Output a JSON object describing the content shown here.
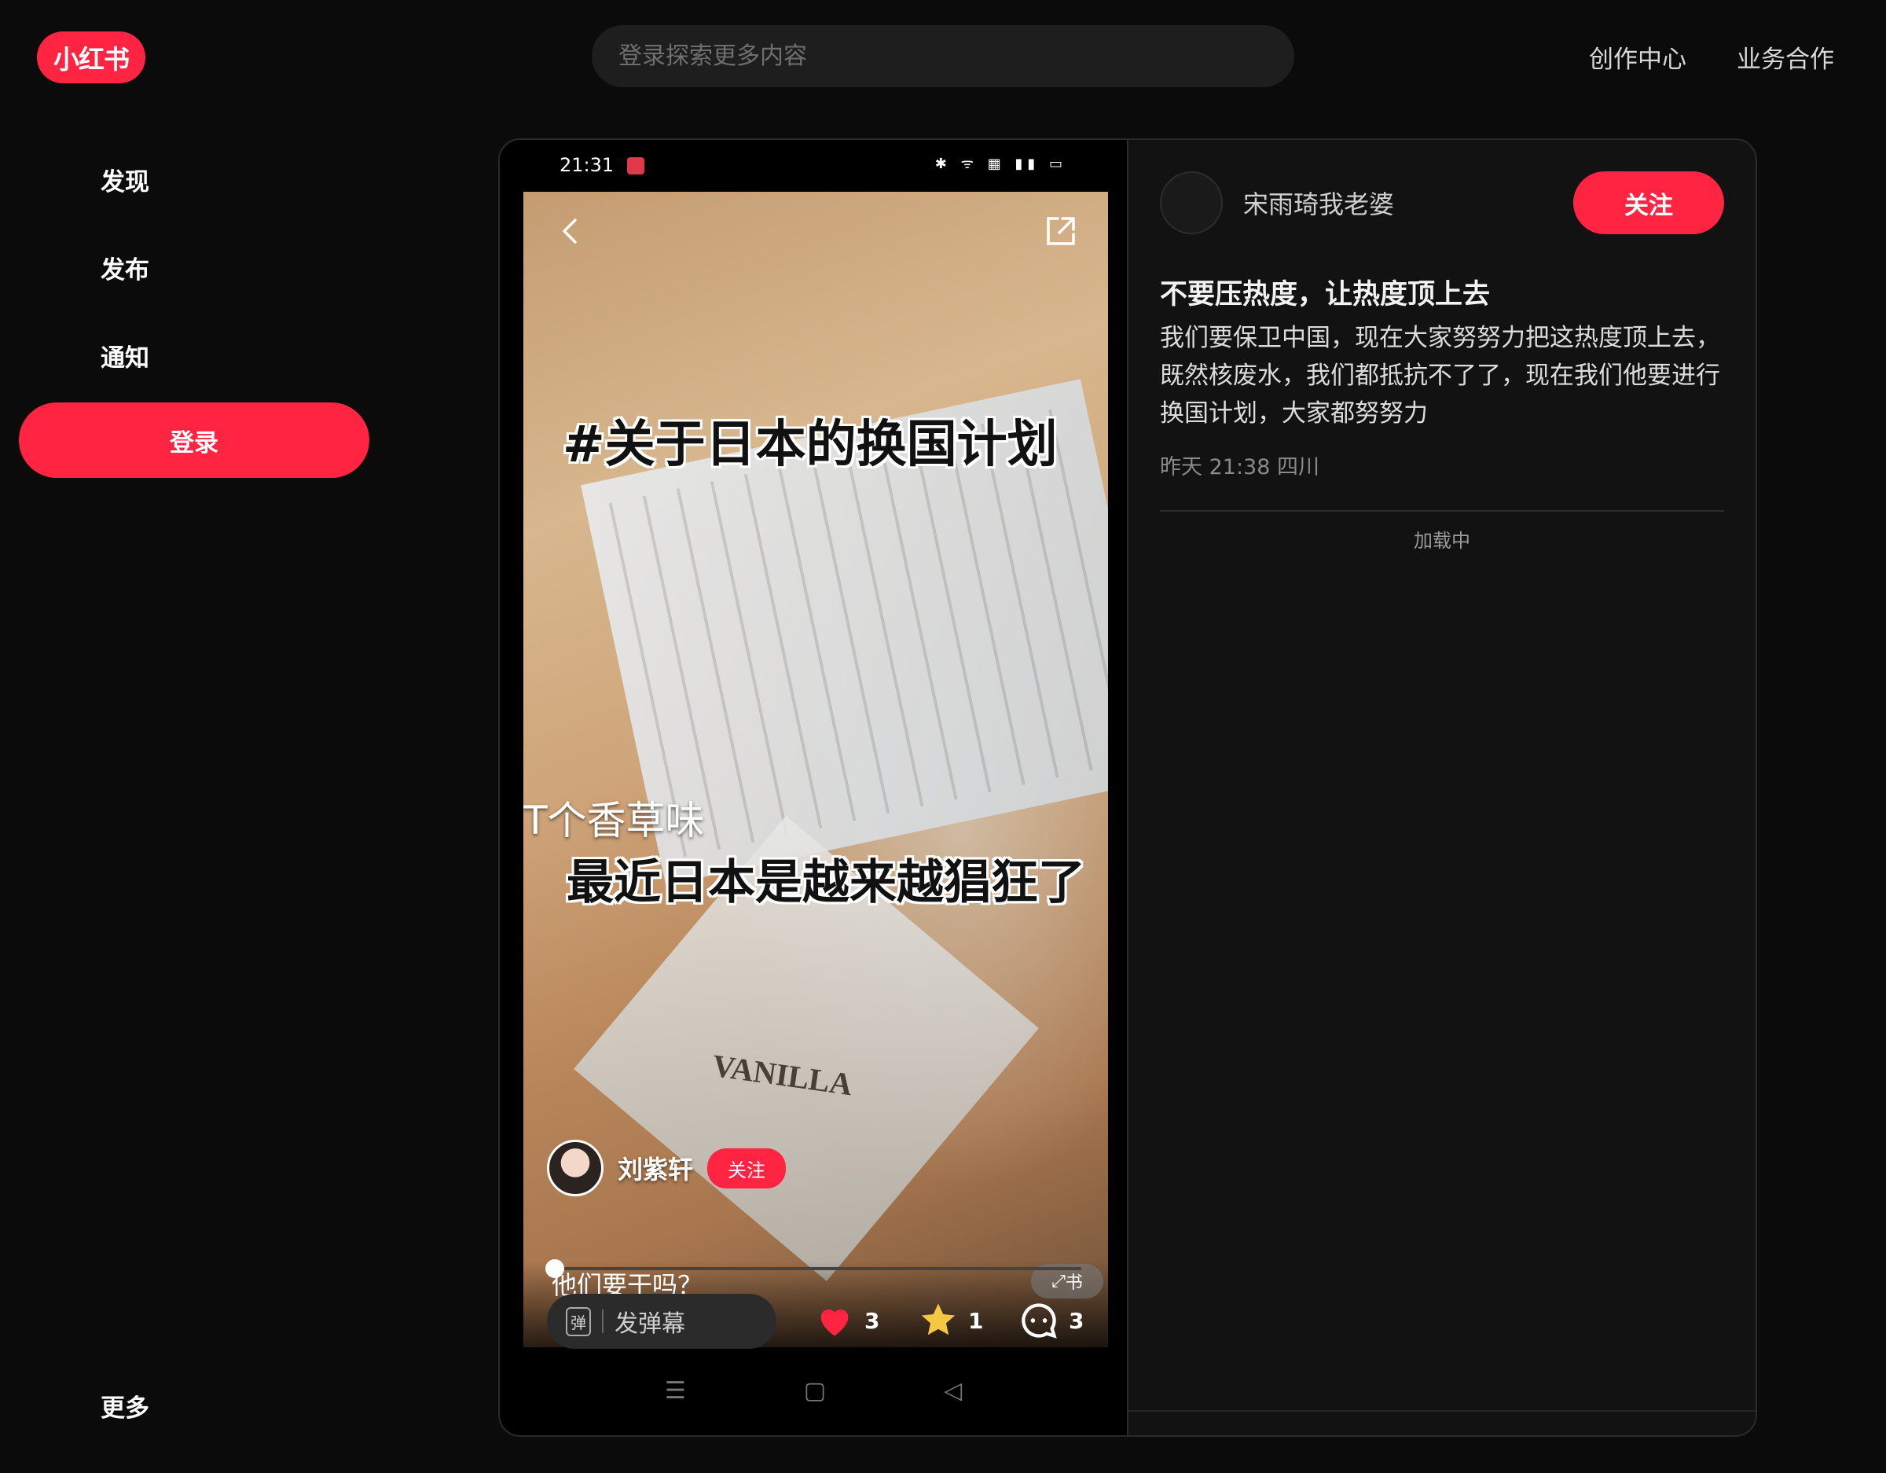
{
  "header": {
    "logo": "小红书",
    "search_placeholder": "登录探索更多内容",
    "links": [
      "创作中心",
      "业务合作"
    ]
  },
  "sidebar": {
    "items": [
      "发现",
      "发布",
      "通知"
    ],
    "login": "登录",
    "more": "更多"
  },
  "video": {
    "status_time": "21:31",
    "captions": [
      "#关于日本的换国计划",
      "T个香草味",
      "最近日本是越来越猖狂了"
    ],
    "product_label": "VANILLA",
    "author": "刘紫轩",
    "author_follow": "关注",
    "description": "他们要干吗？",
    "fullscreen_label": "书",
    "progress": 0.01,
    "danmu_placeholder": "发弹幕",
    "danmu_icon_label": "弹",
    "likes": "3",
    "collects": "1",
    "comments": "3",
    "nav_icons": [
      "☰",
      "▢",
      "◁"
    ]
  },
  "note": {
    "author": "宋雨琦我老婆",
    "follow": "关注",
    "title": "不要压热度，让热度顶上去",
    "body": "我们要保卫中国，现在大家努努力把这热度顶上去，既然核废水，我们都抵抗不了了，现在我们他要进行换国计划，大家都努努力",
    "meta": "昨天 21:38 四川",
    "loading": "加载中"
  },
  "colors": {
    "brand": "#ff2442",
    "background": "#0b0b0b"
  }
}
